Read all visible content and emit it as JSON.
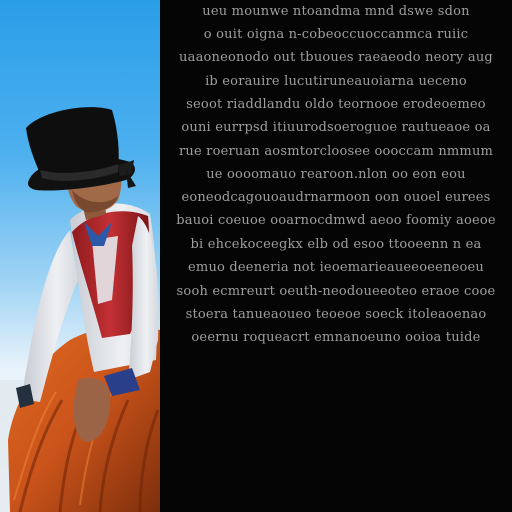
{
  "image": {
    "left_panel": {
      "subject": "figure in a black top hat, white shirt, red vest and orange ruffled skirt",
      "colors": {
        "sky_top": "#2a9ee8",
        "sky_bottom": "#f4f6f8",
        "hat": "#0e0e0e",
        "shirt": "#e4e6ea",
        "vest": "#b8282a",
        "skirt": "#c9531a",
        "skin": "#a06a48"
      }
    },
    "right_panel": {
      "background": "#050505",
      "text_color": "#b9b9b9",
      "lines": [
        "ueu mounwe ntoandma mnd dswe sdon",
        "o ouit oigna n-cobeoccuoccanmca ruiic",
        "uaaoneonodo out tbuoues raeaeodo neory aug",
        "ib eorauire lucutiruneauoiarna ueceno",
        "seoot riaddlandu oldo teornooe erodeoemeo",
        "ouni eurrpsd itiuurodsoeroguoe rautueaoe oa",
        "rue roeruan aosmtorcloosee oooccam nmmum",
        "ue oooomauo rearoon.nlon oo  eon eou",
        "eoneodcagouoaudrnarmoon oon ouoel eurees",
        "bauoi coeuoe ooarnocdmwd aeoo foomiy aoeoe",
        "bi ehcekoceegkx elb od esoo ttooeenn n ea",
        "emuo deeneria not ieoemarieaueeoeeneoeu",
        "sooh ecmreurt oeuth-neodoueeoteo eraoe cooe",
        "stoera tanueaoueo teoeoe soeck itoleaoenao",
        "oeernu roqueacrt emnanoeuno ooioa tuide"
      ]
    }
  }
}
